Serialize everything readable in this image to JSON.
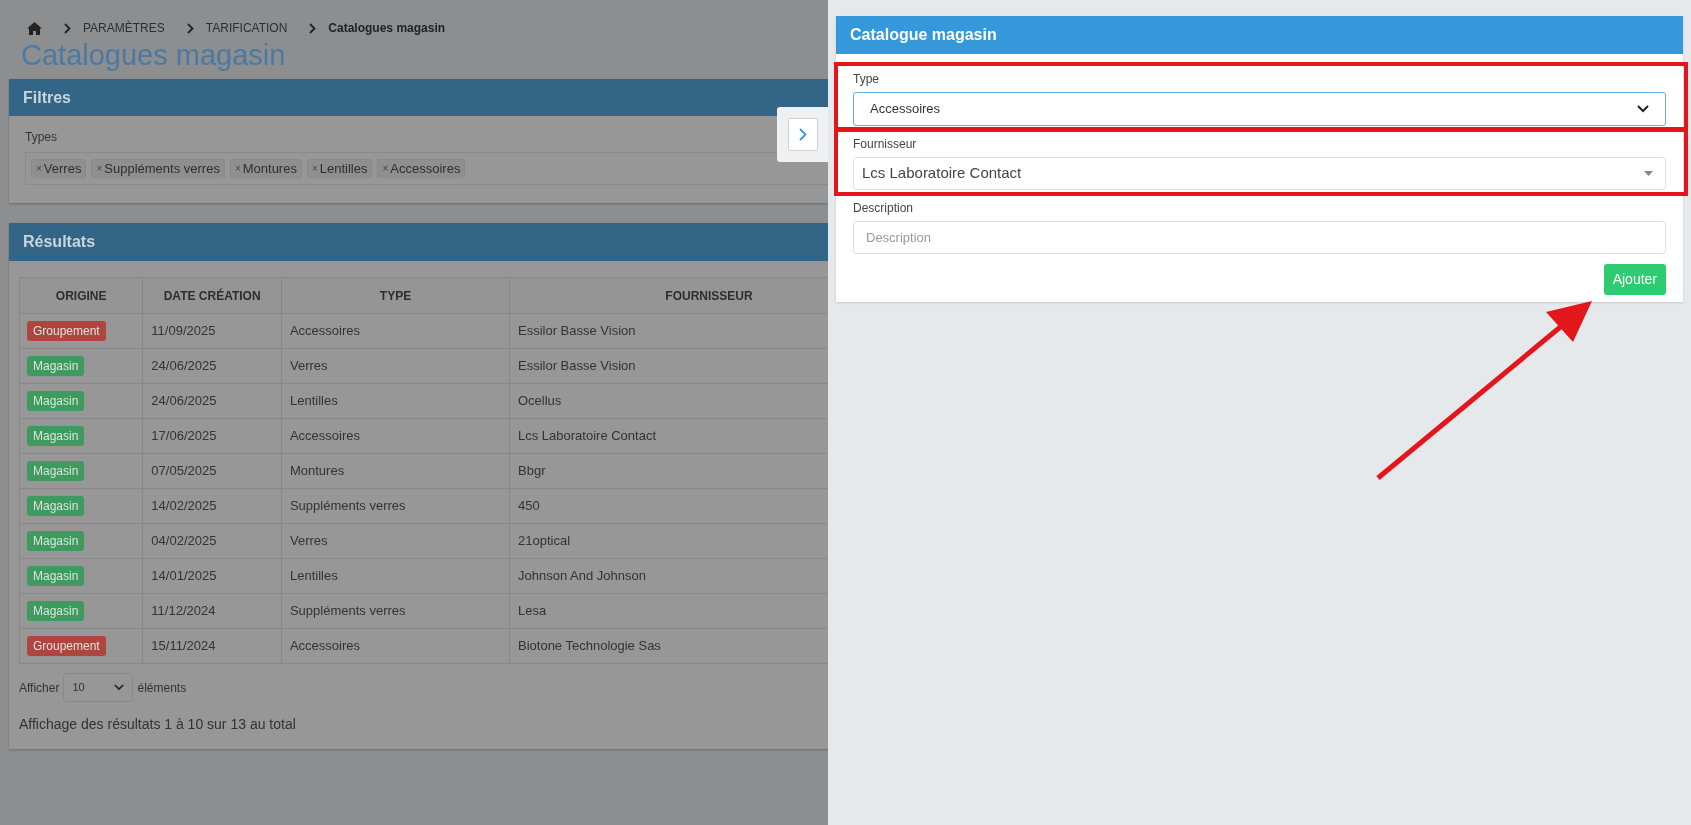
{
  "breadcrumb": [
    {
      "label": "PARAMÈTRES",
      "current": false
    },
    {
      "label": "TARIFICATION",
      "current": false
    },
    {
      "label": "Catalogues magasin",
      "current": true
    }
  ],
  "page_title": "Catalogues magasin",
  "filters": {
    "title": "Filtres",
    "field_label": "Types",
    "tags": [
      "Verres",
      "Suppléments verres",
      "Montures",
      "Lentilles",
      "Accessoires"
    ],
    "tag_remove": "×"
  },
  "results": {
    "title": "Résultats",
    "columns": [
      "ORIGINE",
      "DATE CRÉATION",
      "TYPE",
      "FOURNISSEUR"
    ],
    "rows": [
      {
        "origin": {
          "label": "Groupement",
          "color": "#b0443e"
        },
        "date": "11/09/2025",
        "type": "Accessoires",
        "supplier": "Essilor Basse Vision"
      },
      {
        "origin": {
          "label": "Magasin",
          "color": "#3e9a5f"
        },
        "date": "24/06/2025",
        "type": "Verres",
        "supplier": "Essilor Basse Vision"
      },
      {
        "origin": {
          "label": "Magasin",
          "color": "#3e9a5f"
        },
        "date": "24/06/2025",
        "type": "Lentilles",
        "supplier": "Ocellus"
      },
      {
        "origin": {
          "label": "Magasin",
          "color": "#3e9a5f"
        },
        "date": "17/06/2025",
        "type": "Accessoires",
        "supplier": "Lcs Laboratoire Contact"
      },
      {
        "origin": {
          "label": "Magasin",
          "color": "#3e9a5f"
        },
        "date": "07/05/2025",
        "type": "Montures",
        "supplier": "Bbgr"
      },
      {
        "origin": {
          "label": "Magasin",
          "color": "#3e9a5f"
        },
        "date": "14/02/2025",
        "type": "Suppléments verres",
        "supplier": "450"
      },
      {
        "origin": {
          "label": "Magasin",
          "color": "#3e9a5f"
        },
        "date": "04/02/2025",
        "type": "Verres",
        "supplier": "21optical"
      },
      {
        "origin": {
          "label": "Magasin",
          "color": "#3e9a5f"
        },
        "date": "14/01/2025",
        "type": "Lentilles",
        "supplier": "Johnson And Johnson"
      },
      {
        "origin": {
          "label": "Magasin",
          "color": "#3e9a5f"
        },
        "date": "11/12/2024",
        "type": "Suppléments verres",
        "supplier": "Lesa"
      },
      {
        "origin": {
          "label": "Groupement",
          "color": "#b0443e"
        },
        "date": "15/11/2024",
        "type": "Accessoires",
        "supplier": "Biotone Technologie Sas"
      }
    ],
    "page_size_label": "Afficher",
    "page_size": "10",
    "page_size_suffix": "éléments",
    "summary": "Affichage des résultats 1 à 10 sur 13 au total"
  },
  "panel": {
    "title": "Catalogue magasin",
    "fields": [
      {
        "kind": "select",
        "label": "Type",
        "value": "Accessoires",
        "highlighted": true
      },
      {
        "kind": "combobox",
        "label": "Fournisseur",
        "value": "Lcs Laboratoire Contact",
        "highlighted": true
      },
      {
        "kind": "text",
        "label": "Description",
        "placeholder": "Description",
        "highlighted": false
      }
    ],
    "button": "Ajouter"
  }
}
